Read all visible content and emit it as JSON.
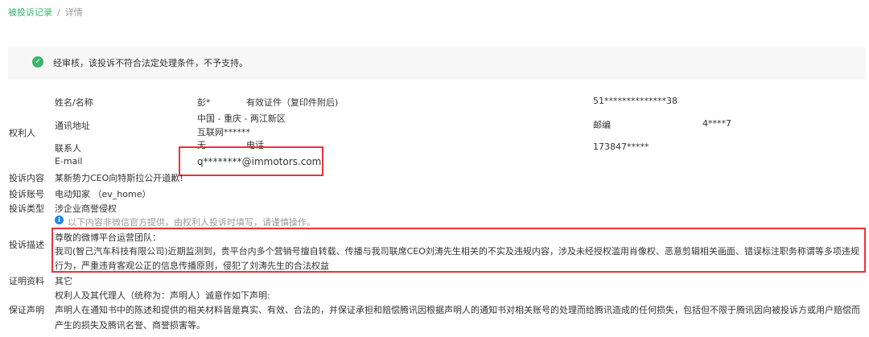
{
  "breadcrumb": {
    "parent": "被投诉记录",
    "separator": "/",
    "current": "详情"
  },
  "banner": {
    "icon": "check-circle-icon",
    "text": "经审核，该投诉不符合法定处理条件，不予支持。"
  },
  "rights_holder": {
    "section_label": "权利人",
    "name_label": "姓名/名称",
    "name_value": "彭*",
    "id_label": "有效证件（复印件附后)",
    "id_value": "51**************38",
    "address_label": "通讯地址",
    "address_line1": "中国 - 重庆 - 两江新区",
    "address_line2": "互联网******",
    "postcode_label": "邮编",
    "postcode_value": "4****7",
    "contact_label": "联系人",
    "contact_value": "无",
    "phone_label": "电话",
    "phone_value": "173847*****",
    "email_label": "E-mail",
    "email_value": "q********@immotors.com"
  },
  "complaint": {
    "content_label": "投诉内容",
    "content_value": "某新势力CEO向特斯拉公开道歉!",
    "account_label": "投诉账号",
    "account_value": "电动知家 （ev_home）",
    "type_label": "投诉类型",
    "type_value": "涉企业商誉侵权",
    "notice": "以下内容非微信官方提供，由权利人投诉时填写，请谨慎操作。",
    "desc_label": "投诉描述",
    "desc_line1": "尊敬的微博平台运营团队：",
    "desc_line2": "我司(智己汽车科技有限公司)近期监测到，贵平台内多个营销号擅自转载、传播与我司联席CEO刘涛先生相关的不实及违规内容，涉及未经授权滥用肖像权、恶意剪辑相关画面、错误标注职务称谓等多项违规",
    "desc_line3": "行为，严重违背客观公正的信息传播原则，侵犯了刘涛先生的合法权益",
    "proof_label": "证明资料",
    "proof_value": "其它"
  },
  "declaration": {
    "label": "保证声明",
    "line1": "权利人及其代理人（统称为：声明人）诚意作如下声明:",
    "line2": "声明人在通知书中的陈述和提供的相关材料皆是真实、有效、合法的，并保证承担和赔偿腾讯因根据声明人的通知书对相关账号的处理而给腾讯造成的任何损失，包括但不限于腾讯因向被投诉方或用户赔偿而",
    "line3": "产生的损失及腾讯名誉、商誉损害等。"
  },
  "colors": {
    "accent": "#3bb56b",
    "highlight": "#e8343c",
    "info": "#1e88e5"
  }
}
